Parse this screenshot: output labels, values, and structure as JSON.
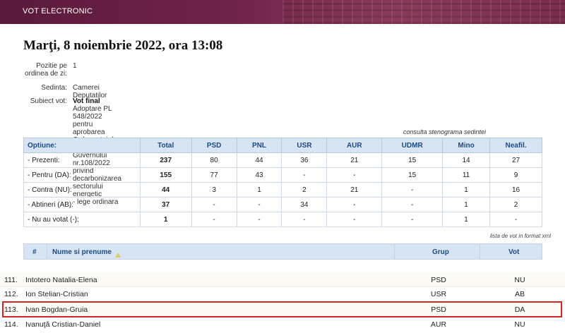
{
  "header": {
    "title": "VOT ELECTRONIC"
  },
  "session": {
    "date_title": "Marţi, 8 noiembrie 2022, ora 13:08",
    "position_label": "Pozitie pe ordinea de zi:",
    "position_value": "1",
    "sitting_label": "Sedinta:",
    "sitting_value": "Camerei Deputatilor",
    "subject_label": "Subiect vot:",
    "subject_title": "Vot final",
    "subject_line1": "Adoptare PL 548/2022 pentru aprobarea Ordonanţei de urgenţă a Guvernului nr.108/2022 privind decarbonizarea sectorului energetic",
    "subject_line2": "- lege ordinara",
    "steno_link": "consulta stenograma sedintei"
  },
  "stats": {
    "columns": [
      "Optiune:",
      "Total",
      "PSD",
      "PNL",
      "USR",
      "AUR",
      "UDMR",
      "Mino",
      "Neafil."
    ],
    "rows": [
      [
        "- Prezenti:",
        "237",
        "80",
        "44",
        "36",
        "21",
        "15",
        "14",
        "27"
      ],
      [
        "- Pentru (DA):",
        "155",
        "77",
        "43",
        "-",
        "-",
        "15",
        "11",
        "9"
      ],
      [
        "- Contra (NU):",
        "44",
        "3",
        "1",
        "2",
        "21",
        "-",
        "1",
        "16"
      ],
      [
        "- Abtineri (AB):",
        "37",
        "-",
        "-",
        "34",
        "-",
        "-",
        "1",
        "2"
      ],
      [
        "- Nu au votat (-):",
        "1",
        "-",
        "-",
        "-",
        "-",
        "-",
        "1",
        "-"
      ]
    ]
  },
  "xml_link": "lista de vot in format xml",
  "list": {
    "col_num": "#",
    "col_name": "Nume si prenume",
    "col_grup": "Grup",
    "col_vot": "Vot",
    "rows": [
      {
        "num": "111.",
        "name": "Intotero Natalia-Elena",
        "grup": "PSD",
        "vot": "NU"
      },
      {
        "num": "112.",
        "name": "Ion Stelian-Cristian",
        "grup": "USR",
        "vot": "AB"
      },
      {
        "num": "113.",
        "name": "Ivan Bogdan-Gruia",
        "grup": "PSD",
        "vot": "DA"
      },
      {
        "num": "114.",
        "name": "Ivanuţă Cristian-Daniel",
        "grup": "AUR",
        "vot": "NU"
      }
    ]
  },
  "colors": {
    "header_bg": "#6e2347",
    "table_header_bg": "#d7e4f3",
    "highlight": "#d7222b"
  }
}
